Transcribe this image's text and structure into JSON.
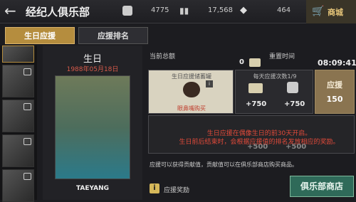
{
  "header": {
    "title": "经纪人俱乐部",
    "resource1": "4775",
    "resource2": "17,568",
    "resource3": "464",
    "shop": "商城"
  },
  "tabs": [
    {
      "label": "生日应援"
    },
    {
      "label": "应援排名"
    }
  ],
  "card": {
    "heading": "生日",
    "date": "1988年05月18日",
    "name": "TAEYANG"
  },
  "stats": {
    "total_label": "当前总额",
    "total_value": "0",
    "reset_label": "重置时间",
    "reset_value": "08:09:41"
  },
  "jar": {
    "title": "生日应援储蓄罐",
    "buy": "眼鼻嘴购买"
  },
  "daily": {
    "title": "每天应援次数1/9",
    "val1": "+750",
    "val2": "+750",
    "val3": "+500",
    "val4": "+500"
  },
  "support_btn": {
    "label": "应援",
    "value": "150"
  },
  "notice": {
    "line1": "生日应援在偶像生日的前30天开启。",
    "line2": "生日前后结束时，会根据应援值的排名发放相应的奖励。"
  },
  "footer": {
    "desc": "应援可以获得贡献值，贡献值可以在俱乐部商店购买商品。",
    "reward": "应援奖励",
    "club_shop": "俱乐部商店"
  },
  "colors": {
    "accent": "#b58d3e",
    "notice": "#e24a3a",
    "shop_btn": "#2f6a59"
  }
}
